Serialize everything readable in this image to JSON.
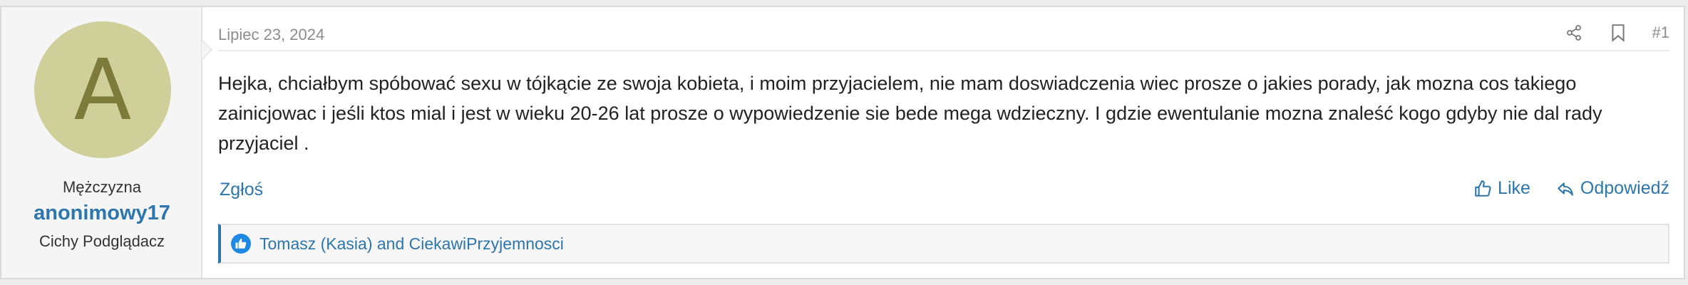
{
  "author": {
    "avatar_letter": "A",
    "gender_title": "Mężczyzna",
    "username": "anonimowy17",
    "rank": "Cichy Podglądacz"
  },
  "post": {
    "date": "Lipiec 23, 2024",
    "number": "#1",
    "message": "Hejka, chciałbym spóbować sexu w tójkącie ze swoja kobieta, i moim przyjacielem, nie mam doswiadczenia wiec prosze o jakies porady, jak mozna cos takiego zainicjowac i jeśli ktos mial i jest w wieku 20-26 lat prosze o wypowiedzenie sie bede mega wdzieczny. I gdzie ewentulanie mozna znaleść kogo gdyby nie dal rady przyjaciel ."
  },
  "actions": {
    "report": "Zgłoś",
    "like": "Like",
    "reply": "Odpowiedź"
  },
  "reactions": {
    "text": "Tomasz (Kasia) and CiekawiPrzyjemnosci"
  },
  "icons": {
    "share": "share-icon",
    "bookmark": "bookmark-icon",
    "like": "thumbs-up-icon",
    "reply": "reply-icon"
  },
  "colors": {
    "link": "#2c76ad",
    "avatar_bg": "#cfcf9a",
    "avatar_fg": "#7b7b3a"
  }
}
